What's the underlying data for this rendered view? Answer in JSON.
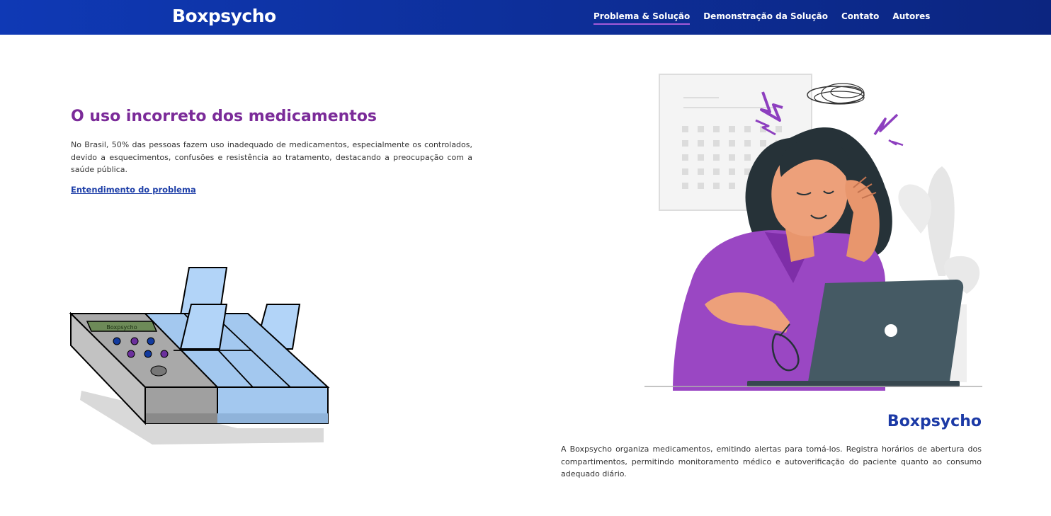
{
  "header": {
    "logo": "Boxpsycho",
    "nav": [
      {
        "label": "Problema & Solução",
        "active": true
      },
      {
        "label": "Demonstração da Solução",
        "active": false
      },
      {
        "label": "Contato",
        "active": false
      },
      {
        "label": "Autores",
        "active": false
      }
    ]
  },
  "problem": {
    "title": "O uso incorreto dos medicamentos",
    "text": "No Brasil, 50% das pessoas fazem uso inadequado de medicamentos, especialmente os controlados, devido a esquecimentos, confusões e resistência ao tratamento, destacando a preocupação com a saúde pública.",
    "link": "Entendimento do problema"
  },
  "device": {
    "screen_text": "Boxpsycho"
  },
  "solution": {
    "title": "Boxpsycho",
    "text": "A Boxpsycho organiza medicamentos, emitindo alertas para tomá-los. Registra horários de abertura dos compartimentos, permitindo monitoramento médico e autoverificação do paciente quanto ao consumo adequado diário."
  },
  "colors": {
    "navbar": "#0f39b5",
    "accent_purple": "#7b2b99",
    "accent_blue": "#1c3aa6",
    "active_underline": "#a45ad8"
  },
  "icons": [
    "pill-box-illustration",
    "stressed-woman-illustration"
  ]
}
